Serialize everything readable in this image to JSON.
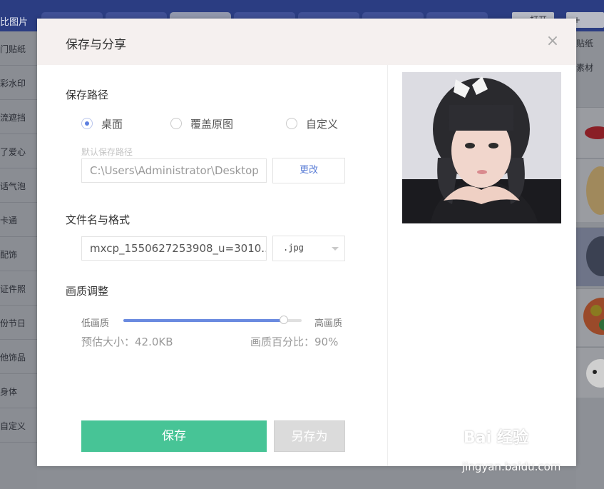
{
  "background_app": {
    "title_fragment": "比图片",
    "sidebar_items": [
      "门贴纸",
      "彩水印",
      "流遮挡",
      "了爱心",
      "话气泡",
      "卡通",
      "配饰",
      "证件照",
      "份节日",
      "他饰品",
      "身体",
      "自定义"
    ],
    "open_label": "打开",
    "new_label": "新建",
    "right_labels": [
      "贴纸",
      "素材"
    ]
  },
  "dialog": {
    "title": "保存与分享",
    "close_icon": "close-icon",
    "save_path": {
      "title": "保存路径",
      "options": [
        {
          "label": "桌面",
          "checked": true
        },
        {
          "label": "覆盖原图",
          "checked": false
        },
        {
          "label": "自定义",
          "checked": false
        }
      ],
      "default_hint": "默认保存路径",
      "path_value": "C:\\Users\\Administrator\\Desktop",
      "change_label": "更改"
    },
    "file": {
      "title": "文件名与格式",
      "name_value": "mxcp_1550627253908_u=3010...",
      "format_value": ".jpg"
    },
    "quality": {
      "title": "画质调整",
      "low_label": "低画质",
      "high_label": "高画质",
      "level": 0.9,
      "size_text": "预估大小：42.0KB",
      "percent_text": "画质百分比：90%"
    },
    "save_label": "保存",
    "save_as_label": "另存为"
  },
  "watermark": {
    "main": "Bai  经验",
    "sub": "jingyan.baidu.com"
  },
  "colors": {
    "accent": "#47c496",
    "link": "#5a7dd6",
    "slider": "#6a8ae0",
    "topbar": "#2b3d82"
  }
}
